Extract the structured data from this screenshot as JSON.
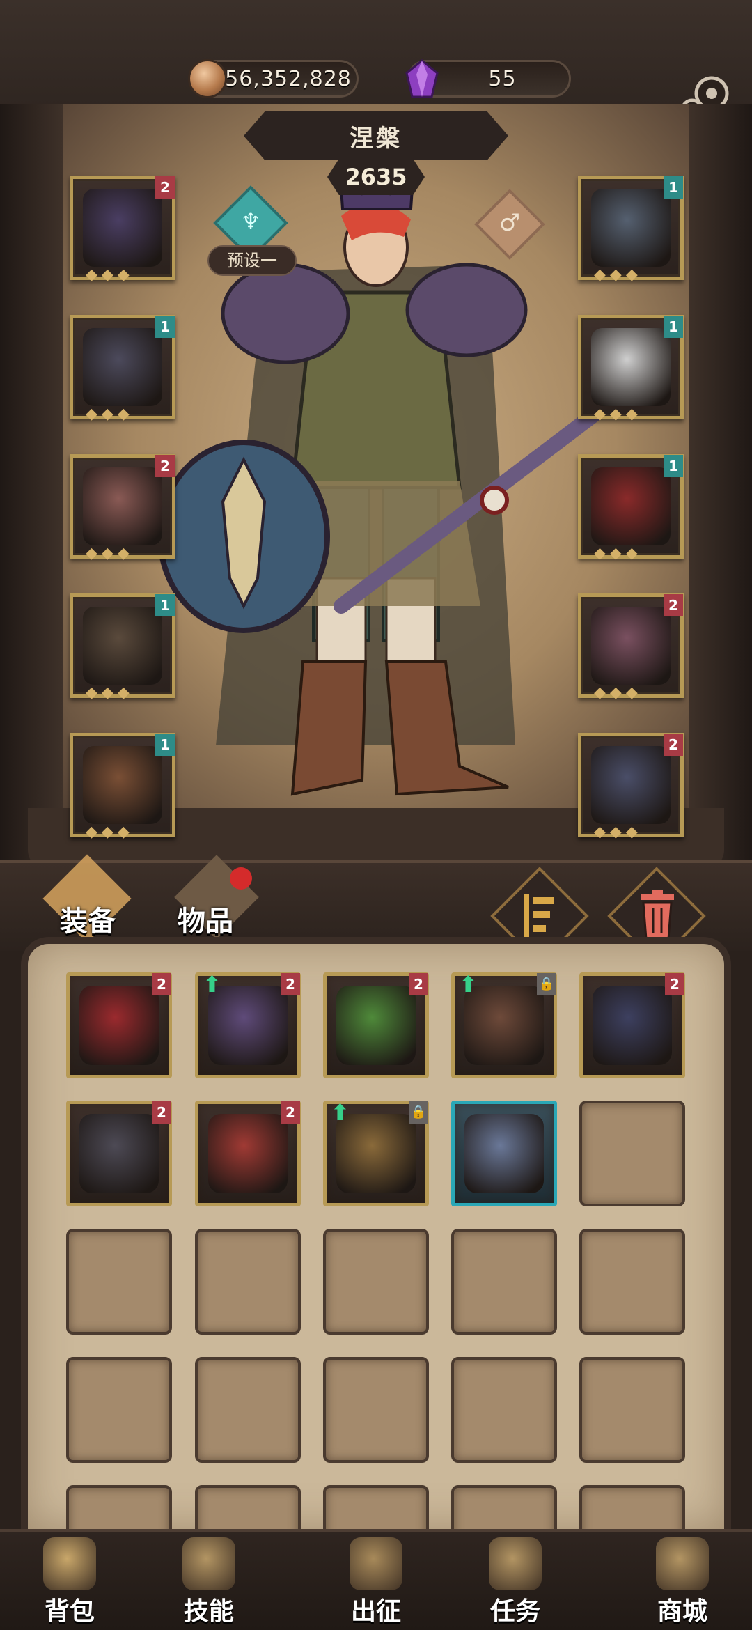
{
  "currency": {
    "gold": "56,352,828",
    "gems": "55"
  },
  "hero": {
    "name": "涅槃",
    "power": "2635",
    "preset": "预设一"
  },
  "tabs": {
    "equipment": "装备",
    "items": "物品"
  },
  "left_slots": [
    {
      "badge": "2",
      "badge_color": "red",
      "art": "crown-icon",
      "color": "#4a3e63"
    },
    {
      "badge": "1",
      "badge_color": "teal",
      "art": "armor-icon",
      "color": "#4c4a5c"
    },
    {
      "badge": "2",
      "badge_color": "red",
      "art": "gauntlet-icon",
      "color": "#8a5a55"
    },
    {
      "badge": "1",
      "badge_color": "teal",
      "art": "pants-icon",
      "color": "#5a4a3c"
    },
    {
      "badge": "1",
      "badge_color": "teal",
      "art": "boots-icon",
      "color": "#7a4f35"
    }
  ],
  "right_slots": [
    {
      "badge": "1",
      "badge_color": "teal",
      "art": "amulet-icon",
      "color": "#556070"
    },
    {
      "badge": "1",
      "badge_color": "teal",
      "art": "feather-cape-icon",
      "color": "#cfcfcf"
    },
    {
      "badge": "1",
      "badge_color": "teal",
      "art": "red-helm-icon",
      "color": "#8a2a2a"
    },
    {
      "badge": "2",
      "badge_color": "red",
      "art": "spiked-club-icon",
      "color": "#7a5060"
    },
    {
      "badge": "2",
      "badge_color": "red",
      "art": "shield-icon",
      "color": "#4a4e68"
    }
  ],
  "inventory": [
    {
      "filled": true,
      "badge": "2",
      "badge_color": "red",
      "art": "red-helmet-icon",
      "color": "#9b2a2e",
      "upgrade": false
    },
    {
      "filled": true,
      "badge": "2",
      "badge_color": "red",
      "art": "skull-gauntlet-icon",
      "color": "#5f4b7a",
      "upgrade": true
    },
    {
      "filled": true,
      "badge": "2",
      "badge_color": "red",
      "art": "green-pendant-icon",
      "color": "#4f8a3a",
      "upgrade": false
    },
    {
      "filled": true,
      "badge": "🔒",
      "badge_color": "grey",
      "art": "hood-icon",
      "color": "#6e4a3a",
      "upgrade": true
    },
    {
      "filled": true,
      "badge": "2",
      "badge_color": "red",
      "art": "dark-armor-icon",
      "color": "#3d4060",
      "upgrade": false
    },
    {
      "filled": true,
      "badge": "2",
      "badge_color": "red",
      "art": "belt-skirt-icon",
      "color": "#4d4a55",
      "upgrade": false
    },
    {
      "filled": true,
      "badge": "2",
      "badge_color": "red",
      "art": "red-boots-icon",
      "color": "#a03a34",
      "upgrade": false
    },
    {
      "filled": true,
      "badge": "🔒",
      "badge_color": "grey",
      "art": "spear-icon",
      "color": "#8a6a3a",
      "upgrade": true
    },
    {
      "filled": true,
      "blue": true,
      "badge": "",
      "badge_color": "",
      "art": "winged-pants-icon",
      "color": "#6a7898",
      "upgrade": false
    },
    {
      "filled": false
    }
  ],
  "nav": [
    {
      "label": "背包",
      "icon": "backpack-icon",
      "color": "#c9a76a"
    },
    {
      "label": "技能",
      "icon": "skill-book-icon",
      "color": "#b39563"
    },
    {
      "label": "出征",
      "icon": "battle-icon",
      "color": "#a88a5a"
    },
    {
      "label": "任务",
      "icon": "quest-scroll-icon",
      "color": "#b39563"
    },
    {
      "label": "商城",
      "icon": "shop-icon",
      "color": "#b39563"
    }
  ]
}
